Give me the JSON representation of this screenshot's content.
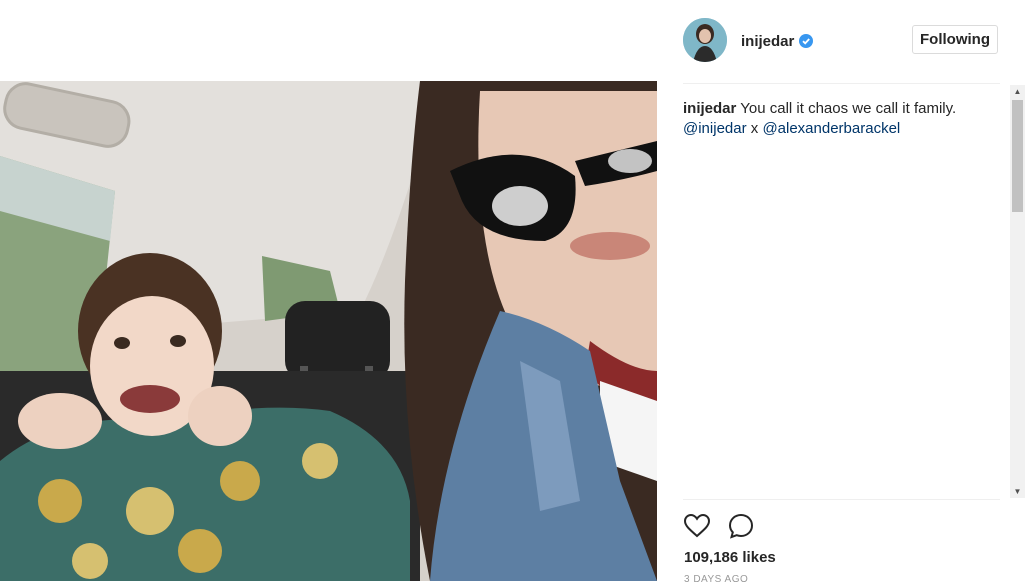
{
  "post": {
    "image_alt": "Selfie of a woman in sunglasses and a young child making a funny face in a car back seat"
  },
  "header": {
    "username": "inijedar",
    "verified": true,
    "follow_button_label": "Following"
  },
  "caption": {
    "username": "inijedar",
    "text": "You call it chaos we call it family.",
    "mention_1": "@inijedar",
    "separator": "x",
    "mention_2": "@alexanderbarackel"
  },
  "actions": {
    "like_icon": "heart-icon",
    "comment_icon": "comment-icon"
  },
  "stats": {
    "likes_label": "109,186 likes"
  },
  "timestamp": "3 DAYS AGO",
  "colors": {
    "link": "#003569",
    "verified_badge": "#3897f0",
    "divider": "#efefef",
    "muted_text": "#999999"
  }
}
